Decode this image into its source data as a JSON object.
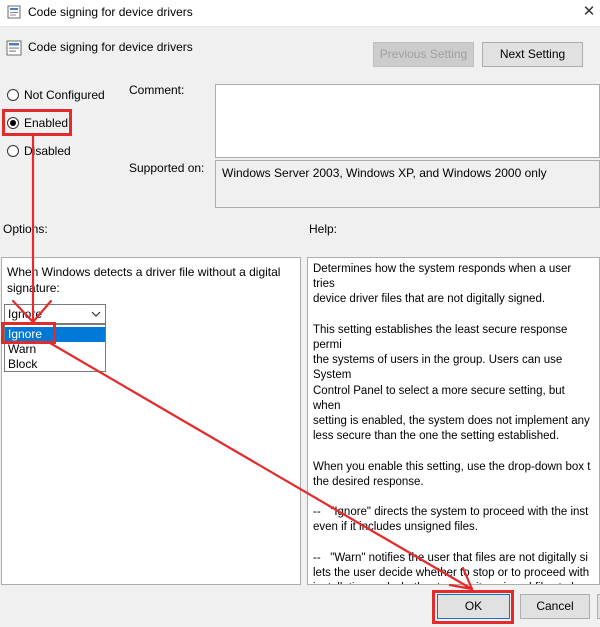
{
  "window": {
    "title": "Code signing for device drivers",
    "title_icon": "policy-setting-icon",
    "close_glyph": "✕"
  },
  "header": {
    "setting_name": "Code signing for device drivers",
    "setting_icon": "policy-setting-icon",
    "previous_setting_label": "Previous Setting",
    "next_setting_label": "Next Setting"
  },
  "state": {
    "options": [
      {
        "label": "Not Configured",
        "selected": false
      },
      {
        "label": "Enabled",
        "selected": true
      },
      {
        "label": "Disabled",
        "selected": false
      }
    ]
  },
  "comment": {
    "label": "Comment:",
    "value": ""
  },
  "supported_on": {
    "label": "Supported on:",
    "value": "Windows Server 2003, Windows XP, and Windows 2000 only"
  },
  "options_pane": {
    "label": "Options:",
    "prompt": "When Windows detects a driver file without a digital signature:",
    "dropdown": {
      "selected": "Ignore",
      "open": true,
      "items": [
        "Ignore",
        "Warn",
        "Block"
      ],
      "highlighted": "Ignore"
    }
  },
  "help_pane": {
    "label": "Help:",
    "text": "Determines how the system responds when a user tries\ndevice driver files that are not digitally signed.\n\nThis setting establishes the least secure response permi\nthe systems of users in the group. Users can use System\nControl Panel to select a more secure setting, but when\nsetting is enabled, the system does not implement any\nless secure than the one the setting established.\n\nWhen you enable this setting, use the drop-down box t\nthe desired response.\n\n--   \"Ignore\" directs the system to proceed with the inst\neven if it includes unsigned files.\n\n--   \"Warn\" notifies the user that files are not digitally si\nlets the user decide whether to stop or to proceed with\ninstallation and whether to permit unsigned files to be\n\"Warn\" is the default.\n\n--   \"Block\" directs the system to refuse to install unsign\nAs a result, the installation stops, and none of the files i"
  },
  "footer": {
    "ok_label": "OK",
    "cancel_label": "Cancel"
  },
  "annotation": {
    "color": "#e32b2b"
  }
}
